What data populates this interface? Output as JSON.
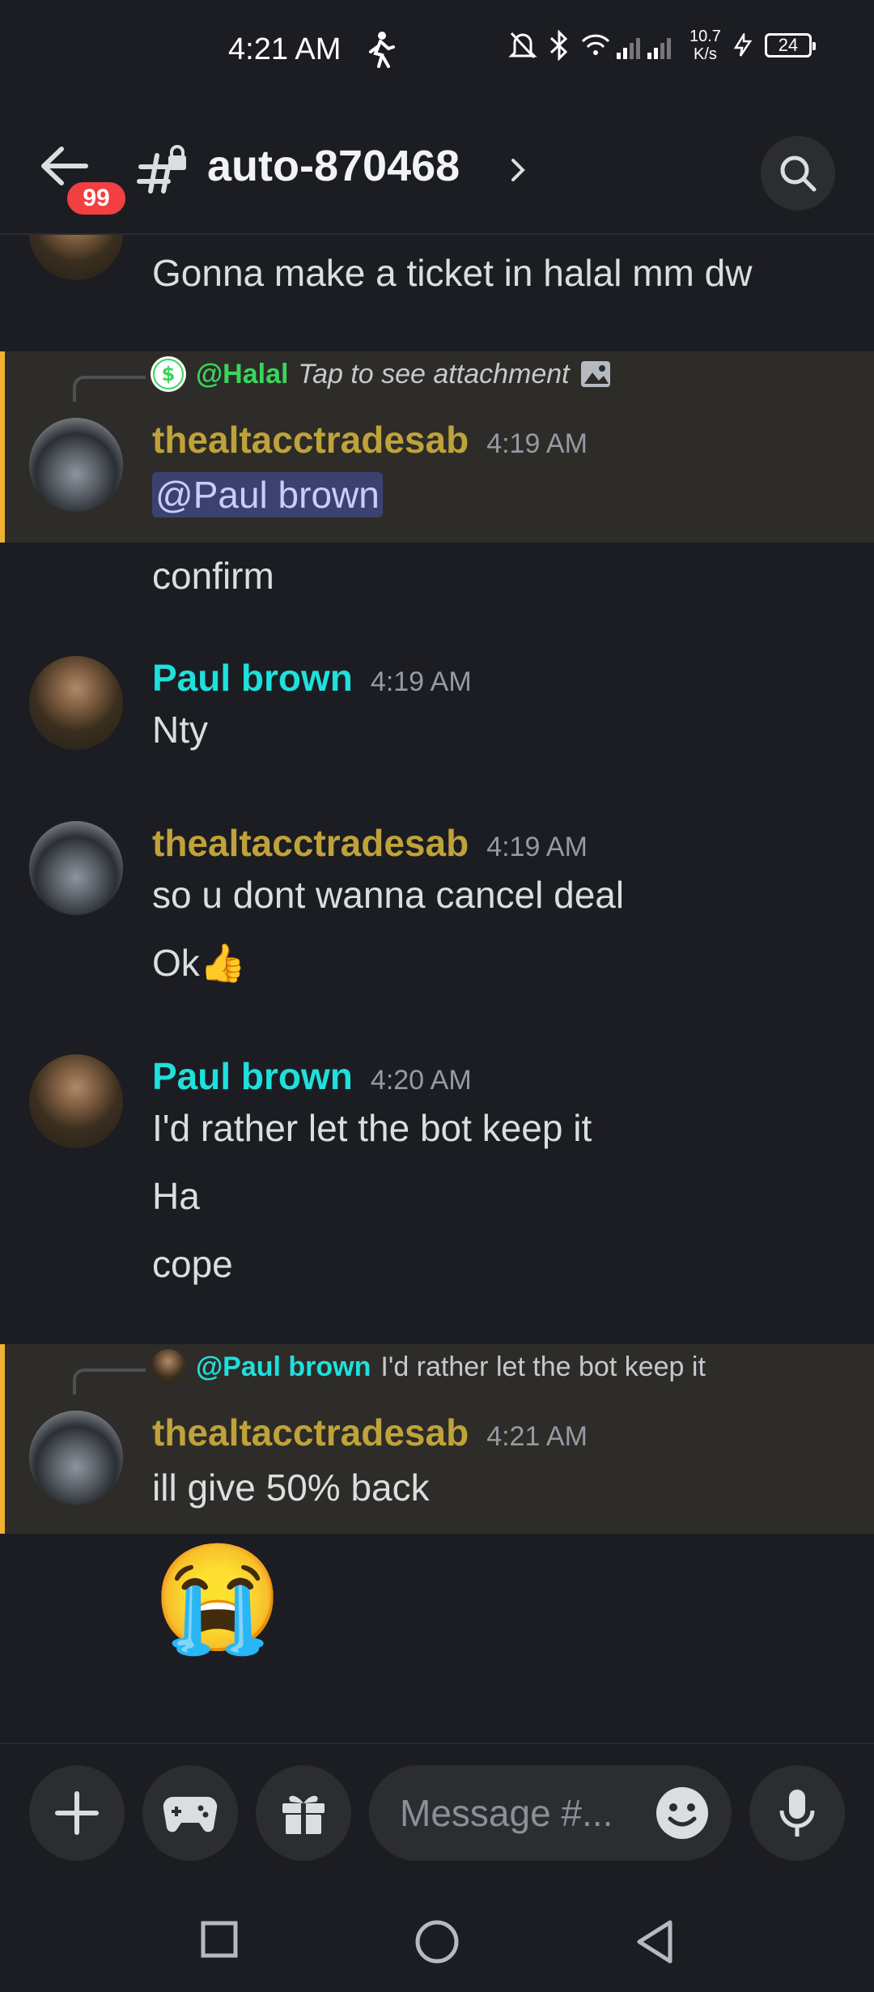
{
  "status_bar": {
    "time": "4:21 AM",
    "net_speed_top": "10.7",
    "net_speed_unit": "K/s",
    "battery": "24"
  },
  "header": {
    "badge_count": "99",
    "channel_name": "auto-870468"
  },
  "messages": [
    {
      "text": "Gonna make a ticket in halal mm dw"
    },
    {
      "reply_to": "@Halal",
      "reply_text": "Tap to see attachment",
      "username": "thealtacctradesab",
      "time": "4:19 AM",
      "mention": "@Paul brown",
      "lines": [
        "confirm"
      ]
    },
    {
      "username": "Paul brown",
      "time": "4:19 AM",
      "lines": [
        "Nty"
      ]
    },
    {
      "username": "thealtacctradesab",
      "time": "4:19 AM",
      "lines": [
        "so u dont wanna cancel deal",
        "Ok👍"
      ]
    },
    {
      "username": "Paul brown",
      "time": "4:20 AM",
      "lines": [
        "I'd rather let the bot keep it",
        "Ha",
        "cope"
      ]
    },
    {
      "reply_to": "@Paul brown",
      "reply_text": "I'd rather let the bot keep it",
      "username": "thealtacctradesab",
      "time": "4:21 AM",
      "lines": [
        "ill give 50% back",
        "😭"
      ]
    }
  ],
  "input": {
    "placeholder": "Message #..."
  },
  "colors": {
    "background": "#1c1d22",
    "username_gold": "#bfa23a",
    "username_cyan": "#1ee0dc",
    "halal_green": "#3ad45c",
    "highlight_bar": "#f0b232",
    "badge_red": "#f23f42"
  }
}
